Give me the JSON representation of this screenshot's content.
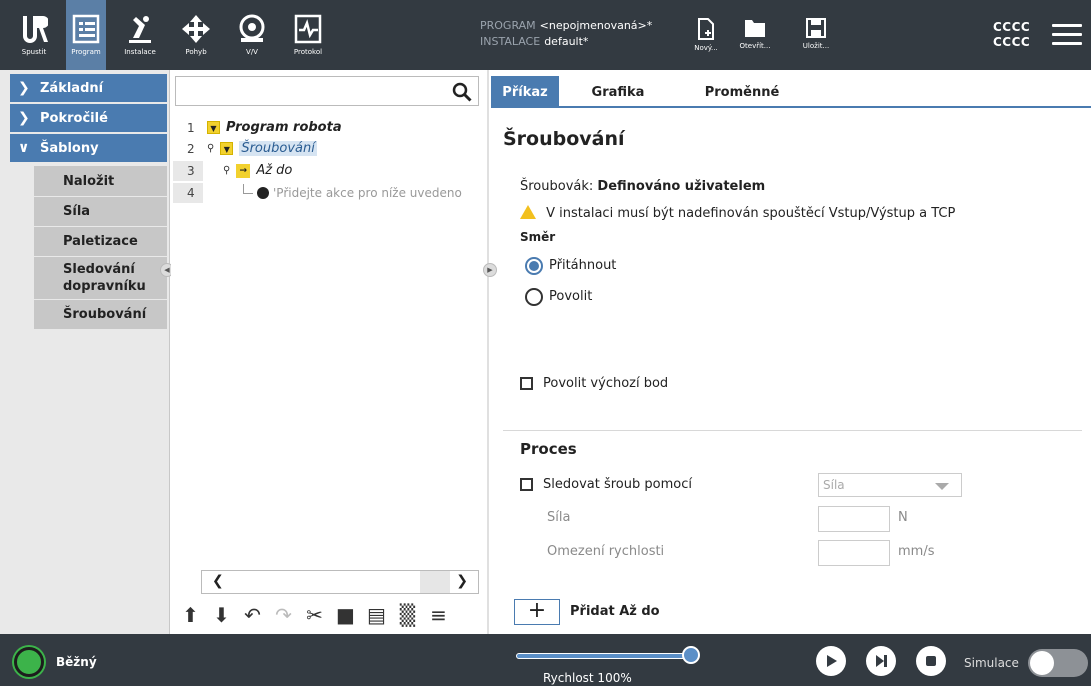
{
  "header": {
    "nav": [
      {
        "label": "Spustit",
        "icon": "ur-logo-icon"
      },
      {
        "label": "Program",
        "icon": "program-icon"
      },
      {
        "label": "Instalace",
        "icon": "installation-icon"
      },
      {
        "label": "Pohyb",
        "icon": "move-icon"
      },
      {
        "label": "V/V",
        "icon": "io-icon"
      },
      {
        "label": "Protokol",
        "icon": "log-icon"
      }
    ],
    "program_key": "PROGRAM",
    "program_value": "<nepojmenovaná>*",
    "install_key": "INSTALACE",
    "install_value": "default*",
    "file_buttons": [
      {
        "label": "Nový...",
        "icon": "new-file-icon"
      },
      {
        "label": "Otevřít...",
        "icon": "folder-icon"
      },
      {
        "label": "Uložit...",
        "icon": "save-icon"
      }
    ],
    "user_line1": "CCCC",
    "user_line2": "CCCC"
  },
  "sidebar": {
    "categories": [
      "Základní",
      "Pokročilé",
      "Šablony"
    ],
    "items": [
      "Naložit",
      "Síla",
      "Paletizace",
      "Sledování dopravníku",
      "Šroubování"
    ]
  },
  "tree": {
    "search_placeholder": "",
    "rows": [
      {
        "num": "1",
        "label": "Program robota"
      },
      {
        "num": "2",
        "label": "Šroubování"
      },
      {
        "num": "3",
        "label": "Až do"
      },
      {
        "num": "4",
        "label": "'Přidejte akce pro níže uvedeno"
      }
    ]
  },
  "tabs": [
    "Příkaz",
    "Grafika",
    "Proměnné"
  ],
  "command": {
    "title": "Šroubování",
    "screwdriver_label": "Šroubovák:",
    "screwdriver_value": "Definováno uživatelem",
    "warning": "V instalaci musí být nadefinován spouštěcí Vstup/Výstup a TCP",
    "direction_label": "Směr",
    "radio_tighten": "Přitáhnout",
    "radio_loosen": "Povolit",
    "radio_selected": "Přitáhnout",
    "start_point_label": "Povolit výchozí bod",
    "process_title": "Proces",
    "track_label": "Sledovat šroub pomocí",
    "track_select_value": "Síla",
    "force_label": "Síla",
    "force_unit": "N",
    "force_value": "",
    "speed_limit_label": "Omezení rychlosti",
    "speed_limit_unit": "mm/s",
    "speed_limit_value": "",
    "add_until_label": "Přidat Až do"
  },
  "footer": {
    "status": "Běžný",
    "speed_label": "Rychlost 100%",
    "speed_fraction": 1.0,
    "simulation_label": "Simulace",
    "simulation_on": false
  },
  "colors": {
    "header_bg": "#333a41",
    "accent": "#4a7bb0",
    "status_green": "#3cb34a"
  }
}
